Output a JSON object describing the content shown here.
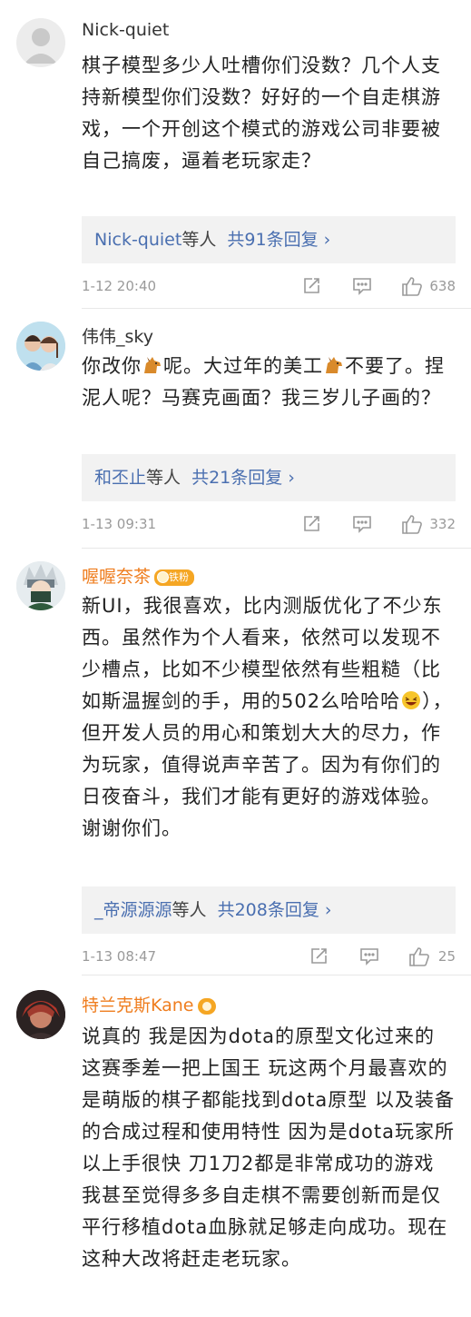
{
  "comments": [
    {
      "username": "Nick-quiet",
      "text": "棋子模型多少人吐槽你们没数？几个人支持新模型你们没数？好好的一个自走棋游戏，一个开创这个模式的游戏公司非要被自己搞废，逼着老玩家走？",
      "reply_user": "Nick-quiet",
      "reply_suffix": "等人",
      "reply_count": "共91条回复",
      "date": "1-12 20:40",
      "likes": "638"
    },
    {
      "username": "伟伟_sky",
      "text_parts": [
        "你改你",
        "呢。大过年的美工",
        "不要了。捏泥人呢？马赛克画面？我三岁儿子画的？"
      ],
      "reply_user": "和丕止",
      "reply_suffix": "等人",
      "reply_count": "共21条回复",
      "date": "1-13 09:31",
      "likes": "332"
    },
    {
      "username": "喔喔奈茶",
      "badge": "铁粉",
      "text_parts": [
        "新UI，我很喜欢，比内测版优化了不少东西。虽然作为个人看来，依然可以发现不少槽点，比如不少模型依然有些粗糙（比如斯温握剑的手，用的502么哈哈哈",
        "），但开发人员的用心和策划大大的尽力，作为玩家，值得说声辛苦了。因为有你们的日夜奋斗，我们才能有更好的游戏体验。谢谢你们。"
      ],
      "reply_user": "_帝源源源",
      "reply_suffix": "等人",
      "reply_count": "共208条回复",
      "date": "1-13 08:47",
      "likes": "25"
    },
    {
      "username": "特兰克斯Kane",
      "text": "说真的 我是因为dota的原型文化过来的 这赛季差一把上国王 玩这两个月最喜欢的是萌版的棋子都能找到dota原型 以及装备的合成过程和使用特性 因为是dota玩家所以上手很快 刀1刀2都是非常成功的游戏 我甚至觉得多多自走棋不需要创新而是仅平行移植dota血脉就足够走向成功。现在这种大改将赶走老玩家。"
    }
  ],
  "icons": {
    "share": "share-icon",
    "comment": "comment-icon",
    "like": "thumbs-up-icon",
    "horse_emoji": "horse-emoji-icon",
    "laugh_emoji": "laughing-emoji-icon"
  },
  "colors": {
    "link": "#4a6fb0",
    "vip_name": "#ef7d1e",
    "badge": "#f5a623",
    "meta": "#9a9a9a",
    "reply_bg": "#f2f2f2"
  }
}
